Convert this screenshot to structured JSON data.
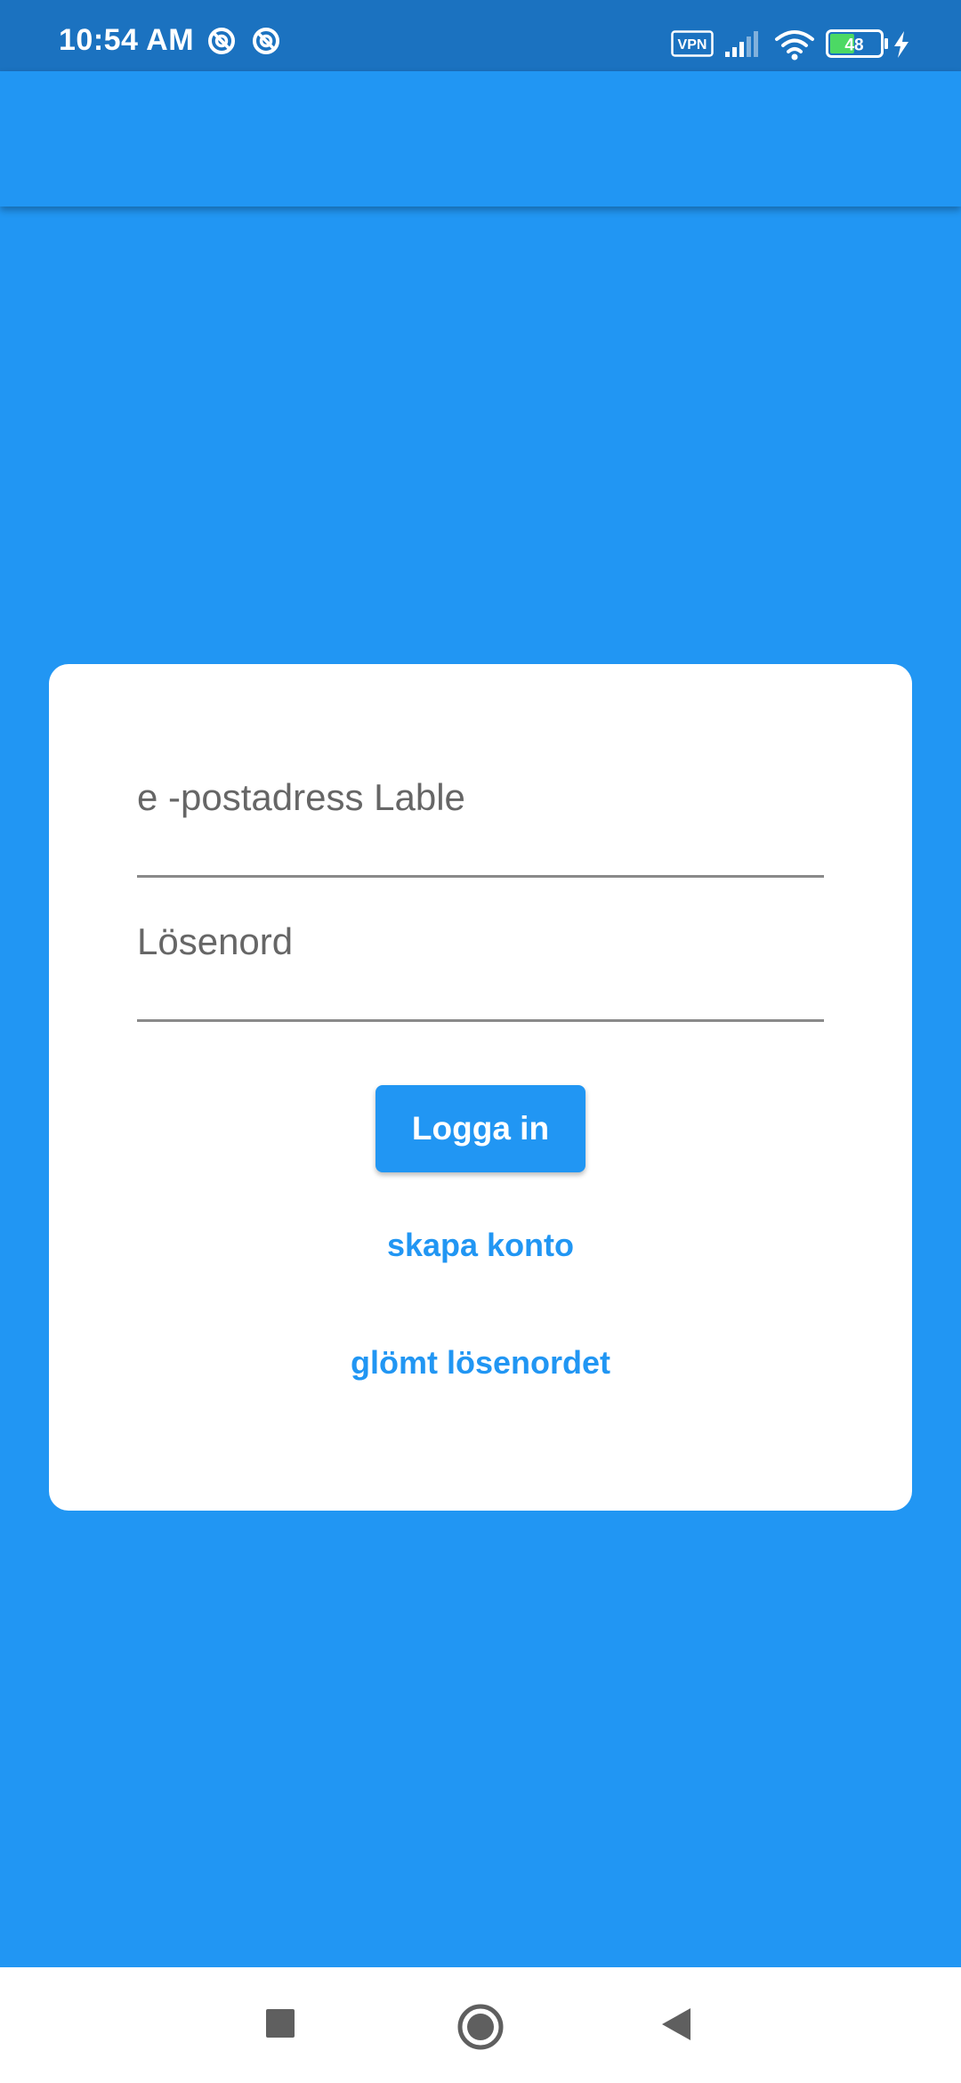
{
  "status_bar": {
    "time": "10:54 AM",
    "vpn_label": "VPN",
    "battery_level": "48"
  },
  "login": {
    "email_placeholder": "e -postadress Lable",
    "password_placeholder": "Lösenord",
    "login_button": "Logga in",
    "create_account_link": "skapa konto",
    "forgot_password_link": "glömt lösenordet"
  },
  "nav_bar": {
    "icons": [
      "recent-apps-icon",
      "home-icon",
      "back-icon"
    ]
  },
  "colors": {
    "primary": "#2196F3",
    "status_bar": "#1B72C0",
    "card": "#FFFFFF",
    "battery_fill": "#4CD964"
  }
}
